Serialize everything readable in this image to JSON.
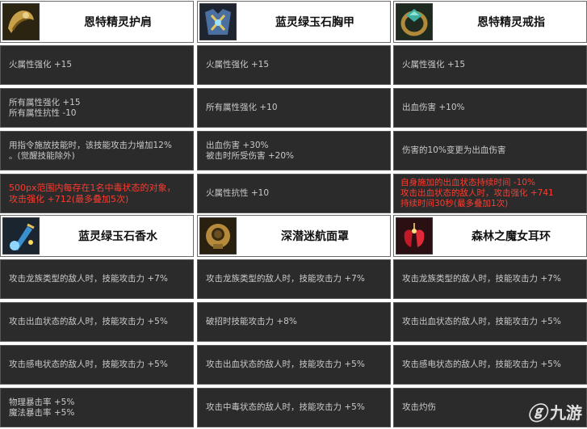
{
  "items": [
    {
      "title": "恩特精灵护肩",
      "icon": "shoulder-armor-icon",
      "stats": [
        {
          "lines": [
            "火属性强化 +15"
          ],
          "red": false
        },
        {
          "lines": [
            "所有属性强化 +15",
            "所有属性抗性 -10"
          ],
          "red": false
        },
        {
          "lines": [
            "用指令施放技能时，该技能攻击力增加12%",
            "。(觉醒技能除外)"
          ],
          "red": false
        },
        {
          "lines": [
            "500px范围内每存在1名中毒状态的对象，",
            "攻击强化 +712(最多叠加5次)"
          ],
          "red": true
        }
      ]
    },
    {
      "title": "蓝灵绿玉石胸甲",
      "icon": "chest-armor-icon",
      "stats": [
        {
          "lines": [
            "火属性强化 +15"
          ],
          "red": false
        },
        {
          "lines": [
            "所有属性强化 +10"
          ],
          "red": false
        },
        {
          "lines": [
            "出血伤害 +30%",
            "被击时所受伤害 +20%"
          ],
          "red": false
        },
        {
          "lines": [
            "火属性抗性 +10"
          ],
          "red": false
        }
      ]
    },
    {
      "title": "恩特精灵戒指",
      "icon": "ring-icon",
      "stats": [
        {
          "lines": [
            "火属性强化 +15"
          ],
          "red": false
        },
        {
          "lines": [
            "出血伤害 +10%"
          ],
          "red": false
        },
        {
          "lines": [
            "伤害的10%变更为出血伤害"
          ],
          "red": false
        },
        {
          "lines": [
            "自身施加的出血状态持续时间 -10%",
            "攻击出血状态的敌人时，攻击强化 +741",
            "持续时间30秒(最多叠加1次)"
          ],
          "red": true
        }
      ]
    },
    {
      "title": "蓝灵绿玉石香水",
      "icon": "perfume-icon",
      "stats": [
        {
          "lines": [
            "攻击龙族类型的敌人时，技能攻击力 +7%"
          ],
          "red": false
        },
        {
          "lines": [
            "攻击出血状态的敌人时，技能攻击力 +5%"
          ],
          "red": false
        },
        {
          "lines": [
            "攻击感电状态的敌人时，技能攻击力 +5%"
          ],
          "red": false
        },
        {
          "lines": [
            "物理暴击率 +5%",
            "魔法暴击率 +5%"
          ],
          "red": false
        }
      ]
    },
    {
      "title": "深潜迷航面罩",
      "icon": "diving-mask-icon",
      "stats": [
        {
          "lines": [
            "攻击龙族类型的敌人时，技能攻击力 +7%"
          ],
          "red": false
        },
        {
          "lines": [
            "破招时技能攻击力 +8%"
          ],
          "red": false
        },
        {
          "lines": [
            "攻击出血状态的敌人时，技能攻击力 +5%"
          ],
          "red": false
        },
        {
          "lines": [
            "攻击中毒状态的敌人时，技能攻击力 +5%"
          ],
          "red": false
        }
      ]
    },
    {
      "title": "森林之魔女耳环",
      "icon": "earring-icon",
      "stats": [
        {
          "lines": [
            "攻击龙族类型的敌人时，技能攻击力 +7%"
          ],
          "red": false
        },
        {
          "lines": [
            "攻击出血状态的敌人时，技能攻击力 +5%"
          ],
          "red": false
        },
        {
          "lines": [
            "攻击感电状态的敌人时，技能攻击力 +5%"
          ],
          "red": false
        },
        {
          "lines": [
            "攻击灼伤"
          ],
          "red": false
        }
      ]
    }
  ],
  "watermark": {
    "logo": "ⓖ",
    "text": "九游"
  },
  "colors": {
    "cell_bg": "#2b2b2b",
    "cell_text": "#c9c9c9",
    "red_text": "#ff3b2f",
    "header_bg": "#ffffff"
  }
}
